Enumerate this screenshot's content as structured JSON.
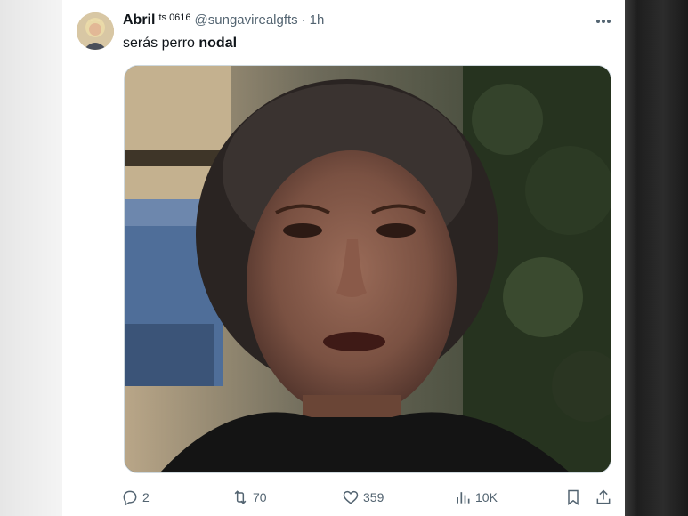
{
  "tweet": {
    "display_name": "Abril",
    "name_suffix": "ts 0616",
    "handle": "@sungavirealgfts",
    "separator": "·",
    "time": "1h",
    "text_plain": "serás perro",
    "text_bold": "nodal"
  },
  "actions": {
    "replies": "2",
    "retweets": "70",
    "likes": "359",
    "views": "10K"
  },
  "icons": {
    "more": "more-horizontal-icon",
    "reply": "reply-bubble-icon",
    "retweet": "retweet-icon",
    "like": "heart-icon",
    "views": "bar-chart-icon",
    "bookmark": "bookmark-icon",
    "share": "share-upload-icon"
  },
  "colors": {
    "text_primary": "#0f1419",
    "text_secondary": "#536471",
    "border": "#cfd9de"
  }
}
